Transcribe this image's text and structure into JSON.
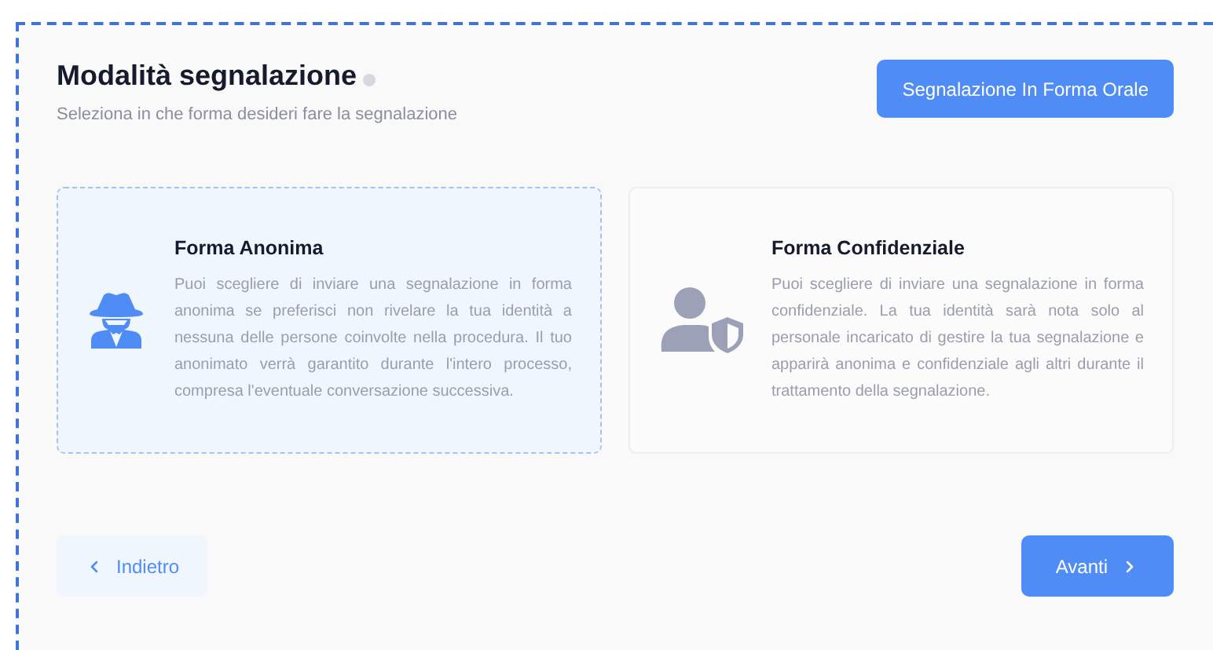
{
  "header": {
    "title": "Modalità segnalazione",
    "subtitle": "Seleziona in che forma desideri fare la segnalazione",
    "oral_button": "Segnalazione In Forma Orale"
  },
  "options": [
    {
      "kind": "anonymous",
      "title": "Forma Anonima",
      "description": "Puoi scegliere di inviare una segnalazione in forma anonima se preferisci non rivelare la tua identità a nessuna delle persone coinvolte nella procedura. Il tuo anonimato verrà garantito durante l'intero processo, compresa l'eventuale conversazione successiva.",
      "selected": true
    },
    {
      "kind": "confidential",
      "title": "Forma Confidenziale",
      "description": "Puoi scegliere di inviare una segnalazione in forma confidenziale. La tua identità sarà nota solo al personale incaricato di gestire la tua segnalazione e apparirà anonima e confidenziale agli altri durante il trattamento della segnalazione.",
      "selected": false
    }
  ],
  "footer": {
    "back": "Indietro",
    "next": "Avanti"
  }
}
